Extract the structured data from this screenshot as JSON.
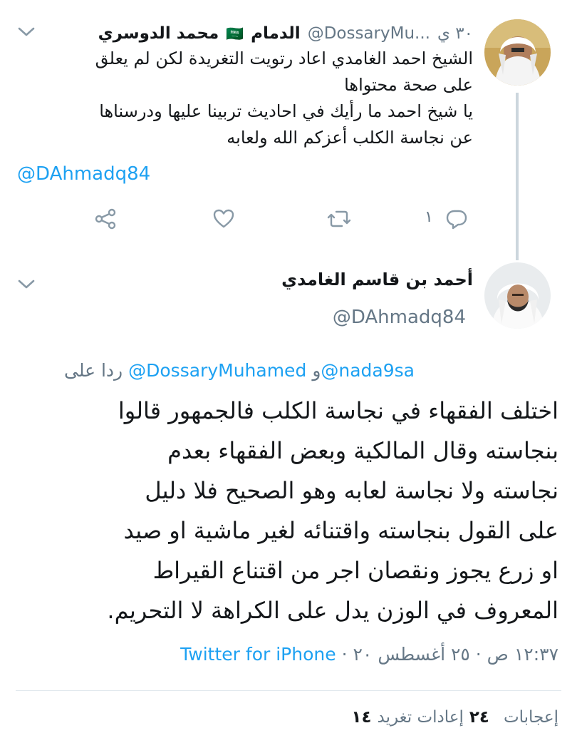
{
  "parent_tweet": {
    "author_name": "محمد الدوسري",
    "flag": "🇸🇦",
    "location": "الدمام",
    "handle": "@DossaryMu...",
    "time": "٣٠ ي",
    "body_lines": [
      "الشيخ احمد الغامدي اعاد رتويت التغريدة لكن لم يعلق",
      "على صحة محتواها",
      "يا شيخ احمد ما رأيك في احاديث تربينا عليها ودرسناها",
      "عن نجاسة الكلب أعزكم الله ولعابه"
    ],
    "mention": "@DAhmadq84",
    "reply_count": "١"
  },
  "main_tweet": {
    "author_name": "أحمد بن قاسم الغامدي",
    "handle": "@DAhmadq84",
    "replying_to_label": "ردا على",
    "replying_to_mention_1": "@DossaryMuhamed",
    "replying_to_and": "و",
    "replying_to_mention_2": "@nada9sa",
    "body_lines": [
      "اختلف الفقهاء في نجاسة الكلب فالجمهور قالوا",
      "بنجاسته وقال المالكية وبعض الفقهاء بعدم",
      "نجاسته ولا نجاسة لعابه وهو الصحيح فلا دليل",
      "على القول بنجاسته واقتنائه لغير ماشية او صيد",
      "او زرع يجوز ونقصان اجر من اقتناع القيراط",
      "المعروف في الوزن يدل على الكراهة لا التحريم."
    ],
    "timestamp": "١٢:٣٧ ص · ٢٥ أغسطس ٢٠ ·",
    "source": "Twitter for iPhone",
    "retweets_count": "١٤",
    "retweets_label": "إعادات تغريد",
    "likes_count": "٢٤",
    "likes_label": "إعجابات"
  },
  "colors": {
    "accent": "#1da1f2",
    "muted": "#657786",
    "divider": "#e1e8ed"
  }
}
